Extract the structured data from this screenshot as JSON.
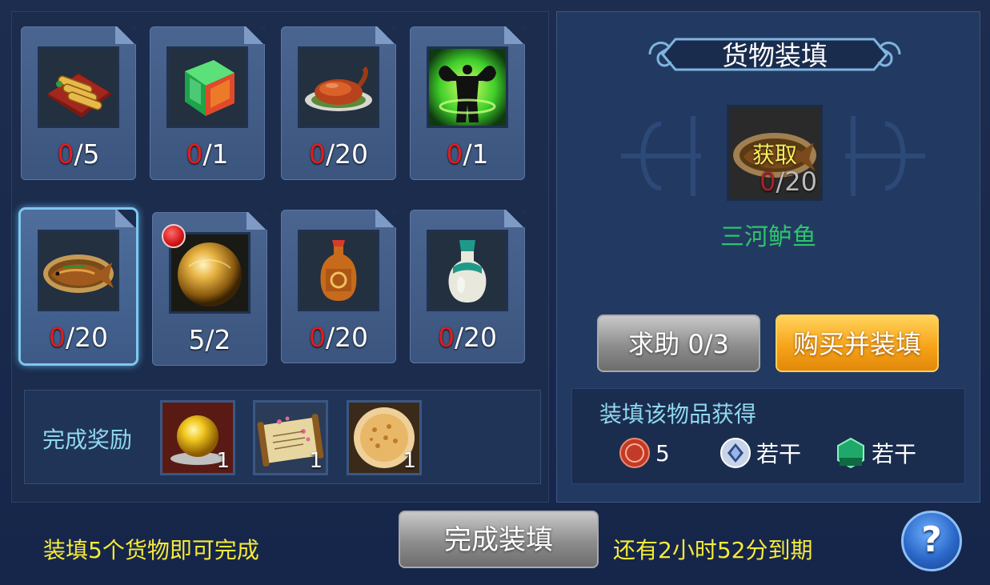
{
  "cargo_items": [
    {
      "icon": "spring-rolls-plate-icon",
      "have": "0",
      "need": "/5"
    },
    {
      "icon": "jade-cube-icon",
      "have": "0",
      "need": "/1"
    },
    {
      "icon": "roast-duck-icon",
      "have": "0",
      "need": "/20"
    },
    {
      "icon": "muscle-buff-icon",
      "have": "0",
      "need": "/1"
    },
    {
      "icon": "braised-fish-icon",
      "have": "0",
      "need": "/20"
    },
    {
      "icon": "golden-orb-icon",
      "have": "",
      "need": "5/2"
    },
    {
      "icon": "red-vase-icon",
      "have": "0",
      "need": "/20"
    },
    {
      "icon": "jade-bottle-icon",
      "have": "0",
      "need": "/20"
    }
  ],
  "reward": {
    "label": "完成奖励",
    "items": [
      {
        "icon": "gold-orb-reward-icon",
        "qty": "1"
      },
      {
        "icon": "scroll-reward-icon",
        "qty": "1"
      },
      {
        "icon": "pancake-reward-icon",
        "qty": "1"
      }
    ]
  },
  "detail": {
    "title": "货物装填",
    "get_label": "获取",
    "have": "0",
    "need": "/20",
    "item_name": "三河鲈鱼",
    "help_button": "求助 0/3",
    "buy_button": "购买并装填",
    "gain_title": "装填该物品获得",
    "gains": [
      {
        "icon": "copper-coin-icon",
        "value": "5"
      },
      {
        "icon": "silver-diamond-icon",
        "value": "若干"
      },
      {
        "icon": "exp-badge-icon",
        "value": "若干"
      }
    ]
  },
  "footer": {
    "hint_left": "装填5个货物即可完成",
    "complete_button": "完成装填",
    "hint_right": "还有2小时52分到期",
    "help": "?"
  },
  "colors": {
    "count_have": "#e31c1c",
    "item_name": "#2ec46a",
    "hint_text": "#f6ea3a",
    "label_text": "#8fd7ef"
  }
}
